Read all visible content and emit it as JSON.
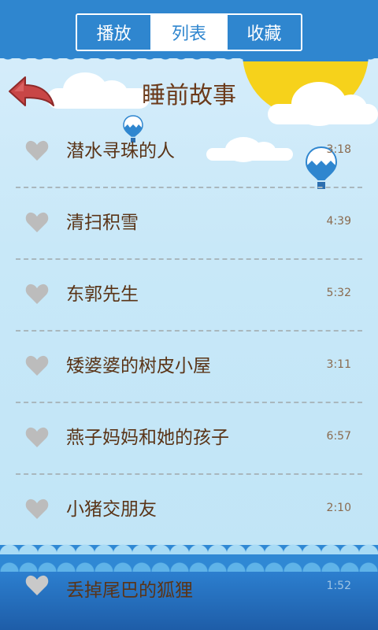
{
  "tabs": [
    {
      "label": "播放",
      "active": false
    },
    {
      "label": "列表",
      "active": true
    },
    {
      "label": "收藏",
      "active": false
    }
  ],
  "page_title": "睡前故事",
  "stories": [
    {
      "name": "潜水寻珠的人",
      "duration": "3:18"
    },
    {
      "name": "清扫积雪",
      "duration": "4:39"
    },
    {
      "name": "东郭先生",
      "duration": "5:32"
    },
    {
      "name": "矮婆婆的树皮小屋",
      "duration": "3:11"
    },
    {
      "name": "燕子妈妈和她的孩子",
      "duration": "6:57"
    },
    {
      "name": "小猪交朋友",
      "duration": "2:10"
    },
    {
      "name": "丢掉尾巴的狐狸",
      "duration": "1:52"
    }
  ],
  "colors": {
    "bar_blue": "#2f86cf",
    "sun_yellow": "#f6d21b",
    "text_brown": "#5a3417",
    "heart_gray": "#bcbcbc",
    "back_red": "#b93a3a"
  },
  "icons": {
    "back": "back-arrow-icon",
    "favorite": "heart-icon"
  }
}
